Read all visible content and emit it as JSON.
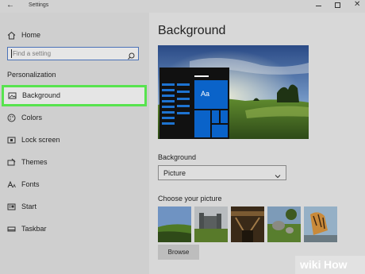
{
  "window": {
    "title": "Settings",
    "back_icon": "back-arrow-icon",
    "minimize_icon": "minimize-icon",
    "maximize_icon": "maximize-icon",
    "close_icon": "close-icon"
  },
  "sidebar": {
    "home_label": "Home",
    "search_placeholder": "Find a setting",
    "section_title": "Personalization",
    "items": [
      {
        "label": "Background",
        "icon": "image-icon",
        "selected": true
      },
      {
        "label": "Colors",
        "icon": "palette-icon",
        "selected": false
      },
      {
        "label": "Lock screen",
        "icon": "lock-screen-icon",
        "selected": false
      },
      {
        "label": "Themes",
        "icon": "brush-icon",
        "selected": false
      },
      {
        "label": "Fonts",
        "icon": "font-icon",
        "selected": false
      },
      {
        "label": "Start",
        "icon": "start-icon",
        "selected": false
      },
      {
        "label": "Taskbar",
        "icon": "taskbar-icon",
        "selected": false
      }
    ],
    "highlight_color": "#57e34e"
  },
  "main": {
    "page_title": "Background",
    "preview_tile_text": "Aa",
    "background_label": "Background",
    "background_value": "Picture",
    "choose_label": "Choose your picture",
    "browse_label": "Browse",
    "accent_color": "#0a63c9"
  },
  "watermark": {
    "prefix": "wiki",
    "suffix": "How",
    "color": "#82b541"
  }
}
